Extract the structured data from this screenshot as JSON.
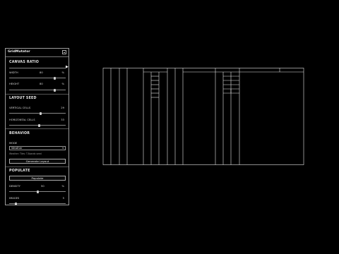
{
  "panel": {
    "title": "GridMutator",
    "canvas_ratio": {
      "heading": "CANVAS RATIO",
      "width_label": "WIDTH",
      "width_value": "80",
      "width_unit": "%",
      "width_level": 0.8,
      "height_label": "HEIGHT",
      "height_value": "80",
      "height_unit": "%",
      "height_level": 0.8
    },
    "layout_seed": {
      "heading": "LAYOUT SEED",
      "vertical_label": "VERTICAL CELLS",
      "vertical_value": "29",
      "vertical_level": 0.56,
      "horizontal_label": "HORIZONTAL CELLS",
      "horizontal_value": "33",
      "horizontal_level": 0.55
    },
    "behavior": {
      "heading": "BEHAVIOR",
      "mode_label": "MODE",
      "mode_value": "Weather",
      "note": "Weather: Tiles: T-Boards seed",
      "generate_label": "Generate Layout"
    },
    "populate": {
      "heading": "POPULATE",
      "populate_button": "Populate",
      "density_label": "DENSITY",
      "density_value": "50",
      "density_unit": "%",
      "density_level": 0.5,
      "images_label": "IMAGES",
      "images_value": "5",
      "images_level": 0.1
    }
  }
}
